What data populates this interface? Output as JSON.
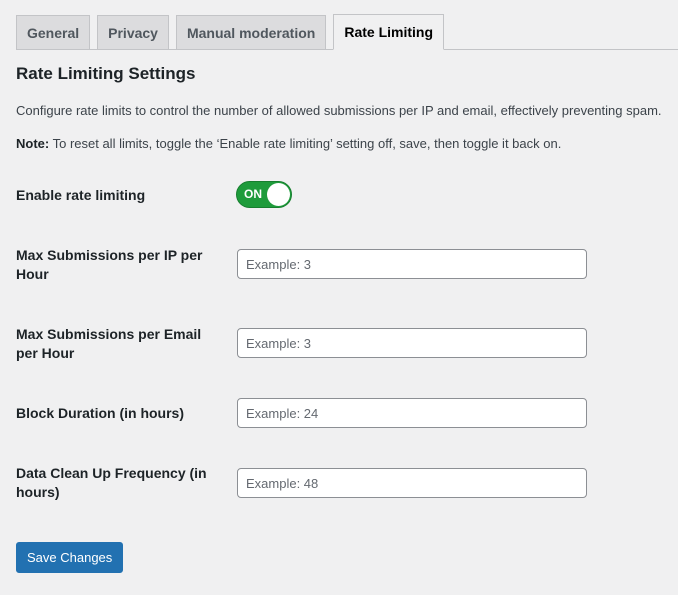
{
  "tabs": [
    {
      "label": "General",
      "active": false
    },
    {
      "label": "Privacy",
      "active": false
    },
    {
      "label": "Manual moderation",
      "active": false
    },
    {
      "label": "Rate Limiting",
      "active": true
    }
  ],
  "section": {
    "title": "Rate Limiting Settings",
    "description": "Configure rate limits to control the number of allowed submissions per IP and email, effectively preventing spam.",
    "note_label": "Note:",
    "note_text": " To reset all limits, toggle the ‘Enable rate limiting’ setting off, save, then toggle it back on."
  },
  "settings": {
    "enable": {
      "label": "Enable rate limiting",
      "state": "ON"
    },
    "max_ip": {
      "label": "Max Submissions per IP per Hour",
      "value": "",
      "placeholder": "Example: 3"
    },
    "max_email": {
      "label": "Max Submissions per Email per Hour",
      "value": "",
      "placeholder": "Example: 3"
    },
    "block_duration": {
      "label": "Block Duration (in hours)",
      "value": "",
      "placeholder": "Example: 24"
    },
    "cleanup": {
      "label": "Data Clean Up Frequency (in hours)",
      "value": "",
      "placeholder": "Example: 48"
    }
  },
  "actions": {
    "save_label": "Save Changes"
  },
  "colors": {
    "primary": "#2271b1",
    "toggle_on": "#1e9b3b"
  }
}
